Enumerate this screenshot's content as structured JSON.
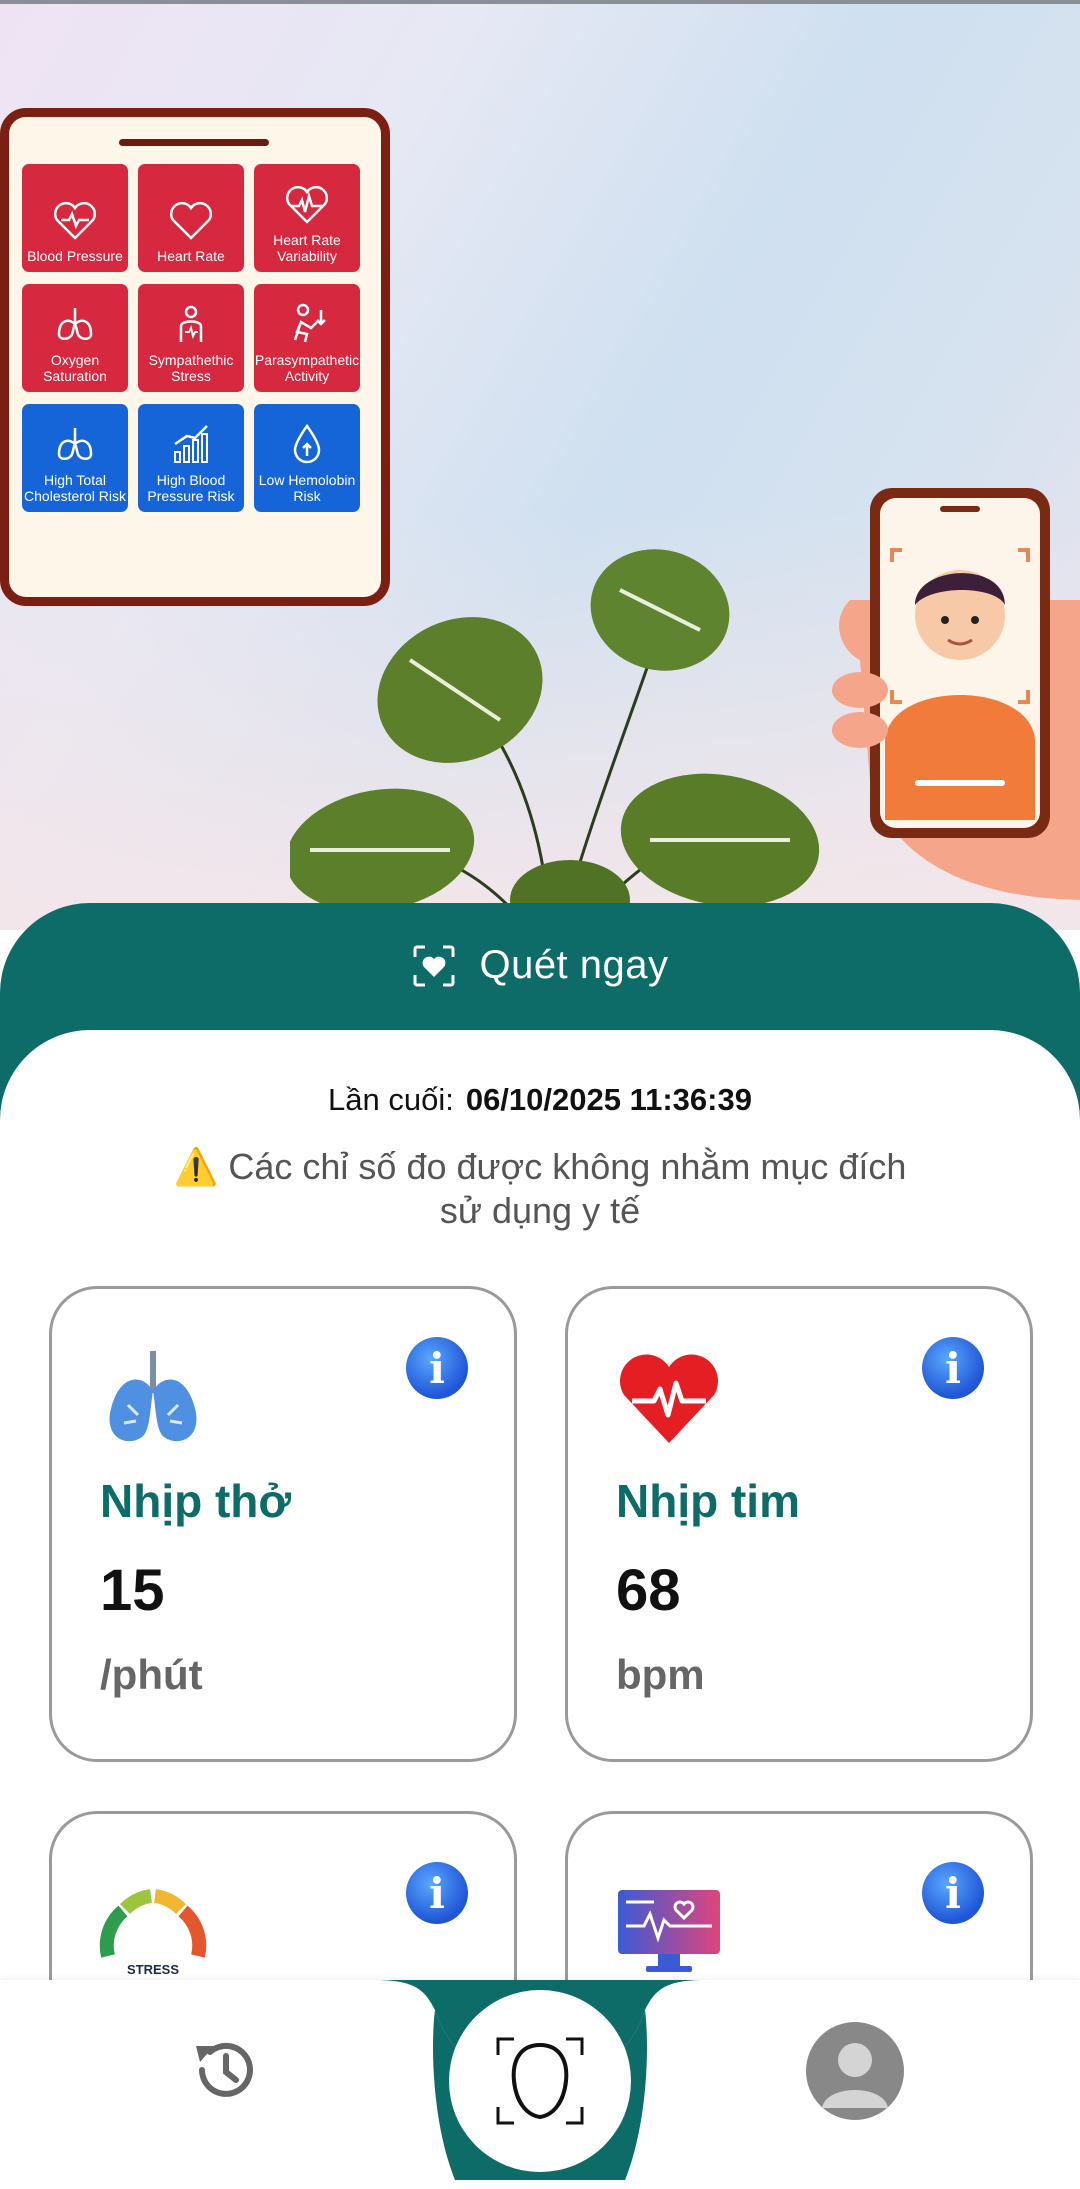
{
  "hero": {
    "tiles": [
      {
        "label": "Blood Pressure",
        "icon": "heart-pulse-icon",
        "color": "red"
      },
      {
        "label": "Heart Rate",
        "icon": "heart-icon",
        "color": "red"
      },
      {
        "label": "Heart Rate Variability",
        "icon": "heart-wave-icon",
        "color": "red"
      },
      {
        "label": "Oxygen Saturation",
        "icon": "lungs-icon",
        "color": "red"
      },
      {
        "label": "Sympathethic Stress",
        "icon": "stress-person-icon",
        "color": "red"
      },
      {
        "label": "Parasympathetic Activity",
        "icon": "relax-person-icon",
        "color": "red"
      },
      {
        "label": "High Total Cholesterol Risk",
        "icon": "lungs-icon",
        "color": "blue"
      },
      {
        "label": "High Blood Pressure Risk",
        "icon": "bar-chart-icon",
        "color": "blue"
      },
      {
        "label": "Low Hemolobin Risk",
        "icon": "drop-icon",
        "color": "blue"
      }
    ]
  },
  "scan": {
    "label": "Quét ngay",
    "icon": "face-scan-icon"
  },
  "last_scan": {
    "label": "Lần cuối:",
    "value": "06/10/2025 11:36:39"
  },
  "warning": {
    "icon": "⚠️",
    "text": "Các chỉ số đo được không nhằm mục đích sử dụng y tế"
  },
  "cards": [
    {
      "title": "Nhịp thở",
      "value": "15",
      "unit": "/phút",
      "icon": "lungs-icon"
    },
    {
      "title": "Nhịp tim",
      "value": "68",
      "unit": "bpm",
      "icon": "heart-rate-icon"
    },
    {
      "title": "",
      "value": "",
      "unit": "",
      "icon": "stress-gauge-icon",
      "gauge_label": "STRESS"
    },
    {
      "title": "",
      "value": "",
      "unit": "",
      "icon": "monitor-heart-icon"
    }
  ],
  "nav": {
    "history": "history-icon",
    "scan": "face-outline-icon",
    "profile": "avatar-icon"
  },
  "colors": {
    "primary": "#0d6b68",
    "tile_red": "#d6283f",
    "tile_blue": "#1565d8",
    "info": "#2f6fe0"
  }
}
